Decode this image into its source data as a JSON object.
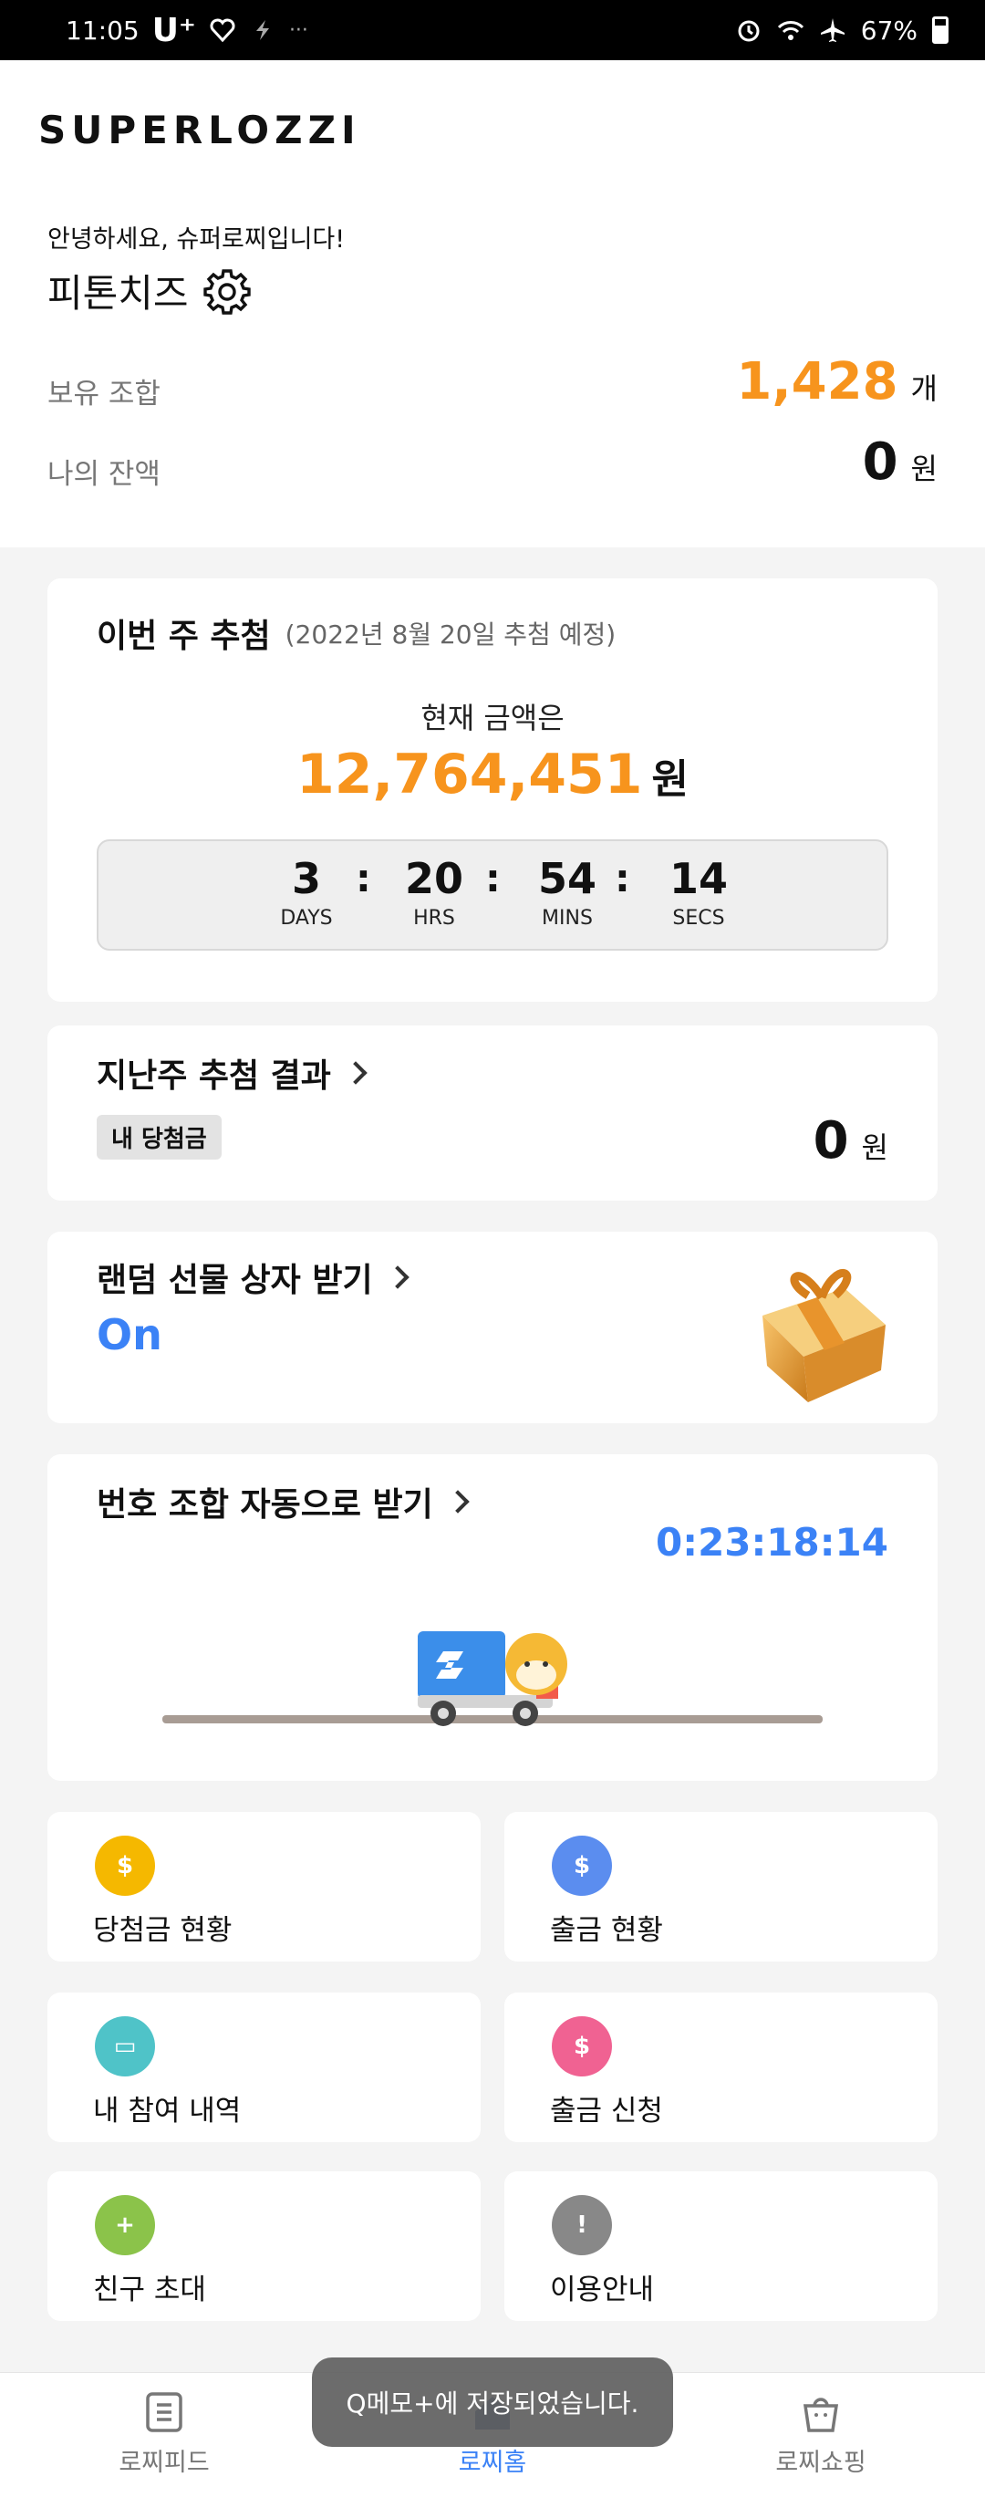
{
  "status": {
    "time": "11:05",
    "carrier": "U⁺",
    "battery": "67%"
  },
  "header": {
    "logo": "SUPERLOZZI"
  },
  "profile": {
    "greeting": "안녕하세요, 슈퍼로찌입니다!",
    "nickname": "피톤치즈",
    "holdings_label": "보유 조합",
    "holdings_value": "1,428",
    "holdings_unit": "개",
    "balance_label": "나의 잔액",
    "balance_value": "0",
    "balance_unit": "원"
  },
  "draw": {
    "title": "이번 주 추첨",
    "subtitle": "(2022년 8월 20일 추첨 예정)",
    "current_label": "현재 금액은",
    "amount": "12,764,451",
    "amount_unit": "원",
    "countdown": [
      {
        "value": "3",
        "label": "DAYS"
      },
      {
        "value": "20",
        "label": "HRS"
      },
      {
        "value": "54",
        "label": "MINS"
      },
      {
        "value": "14",
        "label": "SECS"
      }
    ]
  },
  "last_week": {
    "title": "지난주 추첨 결과",
    "badge": "내 당첨금",
    "value": "0",
    "unit": "원"
  },
  "gift": {
    "title": "랜덤 선물 상자 받기",
    "state": "On"
  },
  "auto": {
    "title": "번호 조합 자동으로 받기",
    "timer": "0:23:18:14"
  },
  "tiles": [
    {
      "label": "당첨금 현황",
      "color": "#f5b800",
      "icon": "wallet-icon"
    },
    {
      "label": "출금 현황",
      "color": "#5b8def",
      "icon": "atm-icon"
    },
    {
      "label": "내 참여 내역",
      "color": "#4fc3c8",
      "icon": "ticket-icon"
    },
    {
      "label": "출금 신청",
      "color": "#f06292",
      "icon": "withdraw-icon"
    },
    {
      "label": "친구 초대",
      "color": "#8bc34a",
      "icon": "add-friend-icon"
    },
    {
      "label": "이용안내",
      "color": "#888888",
      "icon": "warning-icon"
    }
  ],
  "nav": {
    "feed": "로찌피드",
    "home": "로찌홈",
    "shop": "로찌쇼핑"
  },
  "toast": "Q메모+에 저장되었습니다."
}
